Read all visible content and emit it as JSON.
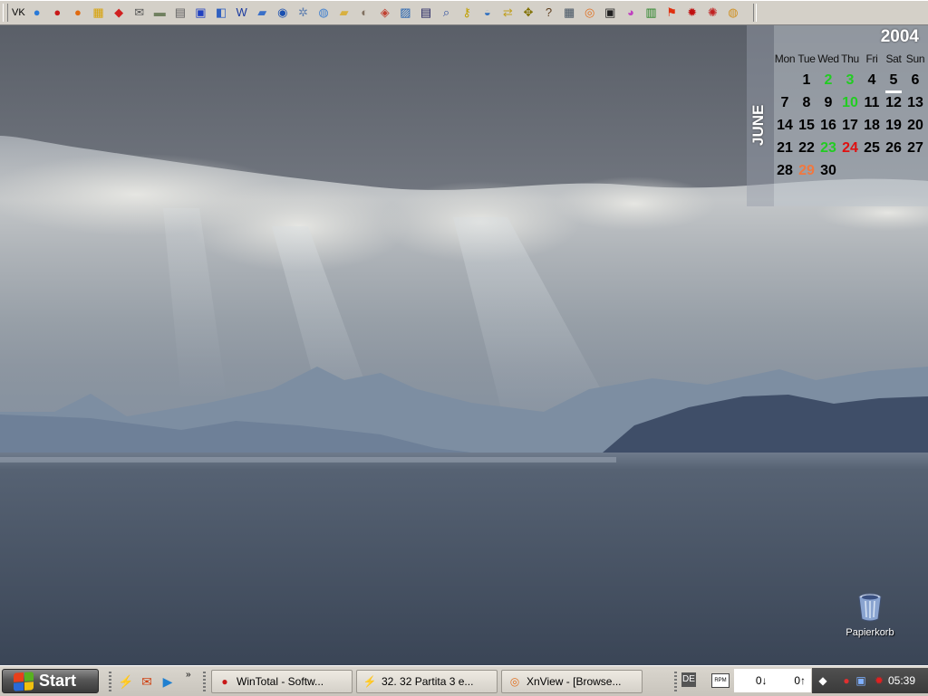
{
  "quick_launch_bar": {
    "label": "VK",
    "icons": [
      {
        "name": "globe-icon",
        "glyph": "●",
        "color": "#2a7ad8"
      },
      {
        "name": "opera-icon",
        "glyph": "●",
        "color": "#c81818"
      },
      {
        "name": "firefox-icon",
        "glyph": "●",
        "color": "#e06a10"
      },
      {
        "name": "bank-icon",
        "glyph": "▦",
        "color": "#d8a000"
      },
      {
        "name": "shredder-icon",
        "glyph": "◆",
        "color": "#d02020"
      },
      {
        "name": "mail-icon",
        "glyph": "✉",
        "color": "#555555"
      },
      {
        "name": "scanner-icon",
        "glyph": "▬",
        "color": "#708060"
      },
      {
        "name": "printer-icon",
        "glyph": "▤",
        "color": "#606060"
      },
      {
        "name": "notepad-icon",
        "glyph": "▣",
        "color": "#2040c0"
      },
      {
        "name": "window-icon",
        "glyph": "◧",
        "color": "#3060c0"
      },
      {
        "name": "word-icon",
        "glyph": "W",
        "color": "#1a3aa0"
      },
      {
        "name": "folder-blue-icon",
        "glyph": "▰",
        "color": "#3a70c8"
      },
      {
        "name": "network-globe-icon",
        "glyph": "◉",
        "color": "#1a50b0"
      },
      {
        "name": "settings-gear-icon",
        "glyph": "✲",
        "color": "#6080b0"
      },
      {
        "name": "database-icon",
        "glyph": "◍",
        "color": "#4080d0"
      },
      {
        "name": "folder-open-icon",
        "glyph": "▰",
        "color": "#d8b040"
      },
      {
        "name": "disk-tool-icon",
        "glyph": "◐",
        "color": "#807060"
      },
      {
        "name": "installer-box-icon",
        "glyph": "◈",
        "color": "#c04030"
      },
      {
        "name": "control-panel-icon",
        "glyph": "▨",
        "color": "#2060b0"
      },
      {
        "name": "system-info-icon",
        "glyph": "▤",
        "color": "#202060"
      },
      {
        "name": "search-computer-icon",
        "glyph": "⌕",
        "color": "#3050a0"
      },
      {
        "name": "keys-icon",
        "glyph": "⚷",
        "color": "#c0a000"
      },
      {
        "name": "network-tool-icon",
        "glyph": "◒",
        "color": "#3070c0"
      },
      {
        "name": "arrows-icon",
        "glyph": "⇄",
        "color": "#c0a020"
      },
      {
        "name": "chip-icon",
        "glyph": "✥",
        "color": "#807000"
      },
      {
        "name": "help-book-icon",
        "glyph": "?",
        "color": "#604020"
      },
      {
        "name": "clipboard-icon",
        "glyph": "▦",
        "color": "#405060"
      },
      {
        "name": "image-viewer-icon",
        "glyph": "◎",
        "color": "#e07020"
      },
      {
        "name": "terminal-icon",
        "glyph": "▣",
        "color": "#202020"
      },
      {
        "name": "color-wheel-icon",
        "glyph": "◕",
        "color": "#c040c0"
      },
      {
        "name": "bar-chart-icon",
        "glyph": "▥",
        "color": "#208020"
      },
      {
        "name": "windows-flag-icon",
        "glyph": "⚑",
        "color": "#e03010"
      },
      {
        "name": "bug-red-icon",
        "glyph": "✹",
        "color": "#c01010"
      },
      {
        "name": "virus-scan-icon",
        "glyph": "✺",
        "color": "#c02020"
      },
      {
        "name": "life-buoy-icon",
        "glyph": "◍",
        "color": "#d09020"
      }
    ]
  },
  "calendar": {
    "year": "2004",
    "month": "JUNE",
    "weekdays": [
      "Mon",
      "Tue",
      "Wed",
      "Thu",
      "Fri",
      "Sat",
      "Sun"
    ],
    "weeks": [
      [
        {
          "d": ""
        },
        {
          "d": "1"
        },
        {
          "d": "2",
          "style": "green"
        },
        {
          "d": "3",
          "style": "green"
        },
        {
          "d": "4"
        },
        {
          "d": "5",
          "style": "today"
        },
        {
          "d": "6"
        }
      ],
      [
        {
          "d": "7"
        },
        {
          "d": "8"
        },
        {
          "d": "9"
        },
        {
          "d": "10",
          "style": "green"
        },
        {
          "d": "11"
        },
        {
          "d": "12"
        },
        {
          "d": "13"
        }
      ],
      [
        {
          "d": "14"
        },
        {
          "d": "15"
        },
        {
          "d": "16"
        },
        {
          "d": "17"
        },
        {
          "d": "18"
        },
        {
          "d": "19"
        },
        {
          "d": "20"
        }
      ],
      [
        {
          "d": "21"
        },
        {
          "d": "22"
        },
        {
          "d": "23",
          "style": "green"
        },
        {
          "d": "24",
          "style": "red"
        },
        {
          "d": "25"
        },
        {
          "d": "26"
        },
        {
          "d": "27"
        }
      ],
      [
        {
          "d": "28"
        },
        {
          "d": "29",
          "style": "orange"
        },
        {
          "d": "30"
        },
        {
          "d": ""
        },
        {
          "d": ""
        },
        {
          "d": ""
        },
        {
          "d": ""
        }
      ]
    ]
  },
  "desktop_icons": [
    {
      "label": "Papierkorb",
      "icon": "recycle-bin-icon"
    }
  ],
  "taskbar": {
    "start_label": "Start",
    "quick_launch": [
      {
        "name": "winamp-icon",
        "glyph": "⚡",
        "color": "#e08000"
      },
      {
        "name": "outlook-express-icon",
        "glyph": "✉",
        "color": "#d04010"
      },
      {
        "name": "media-player-icon",
        "glyph": "▶",
        "color": "#2080d0"
      }
    ],
    "more_label": "»",
    "tasks": [
      {
        "label": "WinTotal - Softw...",
        "icon": "opera-icon",
        "glyph": "●",
        "color": "#c81818"
      },
      {
        "label": "32. 32 Partita 3 e...",
        "icon": "winamp-icon",
        "glyph": "⚡",
        "color": "#e08000"
      },
      {
        "label": "XnView - [Browse...",
        "icon": "image-viewer-icon",
        "glyph": "◎",
        "color": "#e07020"
      }
    ],
    "language": "DE",
    "meter_label": "RPM",
    "net_down": "0↓",
    "net_up": "0↑",
    "clock": "05:39"
  }
}
